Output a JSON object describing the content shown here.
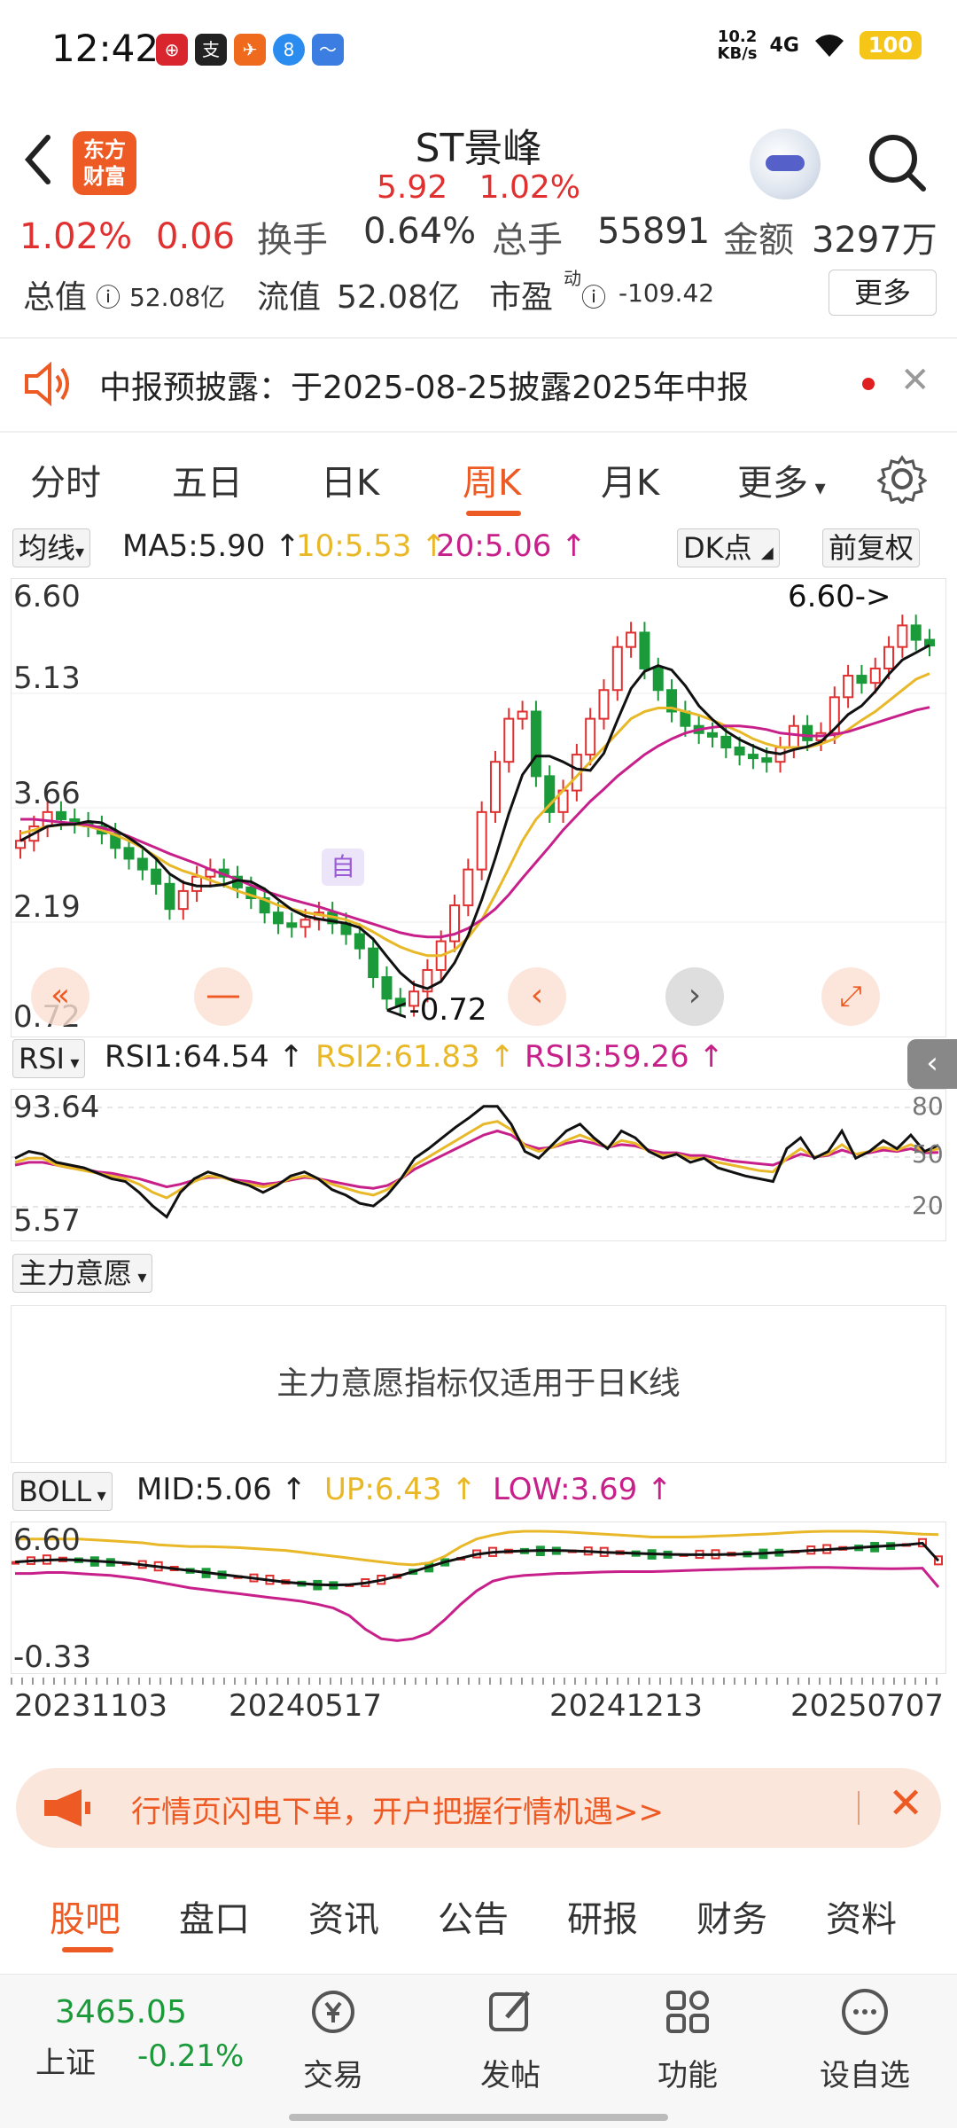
{
  "status": {
    "time": "12:42",
    "net_speed": "10.2",
    "net_unit": "KB/s",
    "signal": "4G",
    "battery": "100"
  },
  "header": {
    "logo_text_top": "东方",
    "logo_text_bottom": "财富",
    "stock_name": "ST景峰",
    "price": "5.92",
    "change_pct": "1.02%"
  },
  "quote": {
    "pct": "1.02%",
    "change": "0.06",
    "turnover_label": "换手",
    "turnover_value": "0.64%",
    "volume_label": "总手",
    "volume_value": "55891",
    "amount_label": "金额",
    "amount_value": "3297万",
    "total_value_label": "总值",
    "total_value": "52.08亿",
    "float_value_label": "流值",
    "float_value": "52.08亿",
    "pe_label": "市盈",
    "pe_sup": "动",
    "pe_value": "-109.42",
    "more_label": "更多"
  },
  "notice": {
    "text": "中报预披露：于2025-08-25披露2025年中报"
  },
  "tabs": [
    "分时",
    "五日",
    "日K",
    "周K",
    "月K",
    "更多"
  ],
  "active_tab_index": 3,
  "ma": {
    "selector": "均线",
    "ma5": "MA5:5.90 ↑",
    "ma10": "10:5.53 ↑",
    "ma20": "20:5.06 ↑",
    "dk": "DK点",
    "adjust": "前复权",
    "y_top": "6.60",
    "y_mid1": "5.13",
    "y_mid2": "3.66",
    "y_mid3": "2.19",
    "y_bottom": "0.72",
    "max_label": "6.60->",
    "min_label": "<-0.72",
    "self_label": "自"
  },
  "rsi": {
    "selector": "RSI",
    "rsi1": "RSI1:64.54 ↑",
    "rsi2": "RSI2:61.83 ↑",
    "rsi3": "RSI3:59.26 ↑",
    "y_top": "93.64",
    "y_bottom": "5.57",
    "r80": "80",
    "r50": "50",
    "r20": "20"
  },
  "main_force": {
    "selector": "主力意愿",
    "message": "主力意愿指标仅适用于日K线"
  },
  "boll": {
    "selector": "BOLL",
    "mid": "MID:5.06 ↑",
    "up": "UP:6.43 ↑",
    "low": "LOW:3.69 ↑",
    "y_top": "6.60",
    "y_bottom": "-0.33"
  },
  "dates": [
    "20231103",
    "20240517",
    "20241213",
    "20250707"
  ],
  "ad": {
    "text": "行情页闪电下单，开户把握行情机遇>>"
  },
  "bottom_tabs": [
    "股吧",
    "盘口",
    "资讯",
    "公告",
    "研报",
    "财务",
    "资料"
  ],
  "dock": {
    "index_value": "3465.05",
    "index_name": "上证",
    "index_pct": "-0.21%",
    "items": [
      "交易",
      "发帖",
      "功能",
      "设自选"
    ]
  },
  "colors": {
    "accent": "#ee5a24",
    "up": "#e03030",
    "down": "#1b9a3a",
    "ma10": "#e8b828",
    "ma20": "#c8208a"
  },
  "chart_data": {
    "type": "candlestick",
    "period": "weekly",
    "ylim": [
      0.72,
      6.6
    ],
    "close": [
      3.2,
      3.4,
      3.6,
      3.5,
      3.45,
      3.4,
      3.3,
      3.1,
      2.95,
      2.8,
      2.6,
      2.25,
      2.5,
      2.7,
      2.8,
      2.7,
      2.55,
      2.4,
      2.2,
      2.05,
      2.0,
      2.1,
      2.2,
      2.05,
      1.9,
      1.7,
      1.3,
      1.0,
      0.9,
      1.1,
      1.4,
      1.8,
      2.3,
      2.8,
      3.6,
      4.3,
      4.9,
      5.0,
      4.1,
      3.6,
      3.9,
      4.4,
      4.9,
      5.3,
      5.9,
      6.1,
      5.6,
      5.3,
      5.0,
      4.8,
      4.7,
      4.65,
      4.5,
      4.4,
      4.35,
      4.3,
      4.5,
      4.8,
      4.6,
      4.7,
      5.2,
      5.5,
      5.4,
      5.6,
      5.9,
      6.2,
      6.0,
      5.92
    ],
    "ma10": [
      3.3,
      3.35,
      3.4,
      3.42,
      3.43,
      3.4,
      3.35,
      3.28,
      3.2,
      3.1,
      2.98,
      2.86,
      2.78,
      2.72,
      2.65,
      2.58,
      2.5,
      2.44,
      2.38,
      2.3,
      2.25,
      2.2,
      2.17,
      2.14,
      2.1,
      2.03,
      1.93,
      1.82,
      1.72,
      1.65,
      1.6,
      1.6,
      1.68,
      1.85,
      2.1,
      2.45,
      2.82,
      3.2,
      3.5,
      3.7,
      3.9,
      4.1,
      4.3,
      4.5,
      4.7,
      4.9,
      5.0,
      5.05,
      5.05,
      5.0,
      4.95,
      4.88,
      4.8,
      4.72,
      4.62,
      4.55,
      4.5,
      4.5,
      4.5,
      4.55,
      4.62,
      4.75,
      4.88,
      5.0,
      5.15,
      5.3,
      5.45,
      5.53
    ],
    "ma20": [
      3.5,
      3.5,
      3.48,
      3.46,
      3.44,
      3.42,
      3.38,
      3.33,
      3.26,
      3.18,
      3.1,
      3.02,
      2.95,
      2.88,
      2.8,
      2.73,
      2.66,
      2.58,
      2.5,
      2.44,
      2.38,
      2.33,
      2.28,
      2.22,
      2.16,
      2.1,
      2.04,
      1.98,
      1.92,
      1.88,
      1.86,
      1.86,
      1.9,
      1.98,
      2.1,
      2.25,
      2.45,
      2.68,
      2.9,
      3.12,
      3.35,
      3.55,
      3.75,
      3.92,
      4.1,
      4.25,
      4.4,
      4.52,
      4.62,
      4.7,
      4.75,
      4.78,
      4.8,
      4.8,
      4.78,
      4.75,
      4.7,
      4.68,
      4.66,
      4.66,
      4.68,
      4.72,
      4.78,
      4.84,
      4.9,
      4.96,
      5.02,
      5.06
    ],
    "rsi1": [
      55,
      60,
      58,
      52,
      50,
      48,
      44,
      40,
      38,
      30,
      20,
      12,
      30,
      40,
      45,
      42,
      38,
      35,
      30,
      35,
      42,
      45,
      40,
      32,
      28,
      22,
      20,
      28,
      40,
      55,
      62,
      70,
      78,
      85,
      93,
      93,
      80,
      60,
      55,
      65,
      75,
      80,
      70,
      62,
      75,
      70,
      60,
      55,
      58,
      52,
      55,
      48,
      45,
      42,
      40,
      38,
      62,
      70,
      55,
      60,
      75,
      55,
      60,
      68,
      62,
      72,
      60,
      64.54
    ],
    "rsi2": [
      52,
      55,
      55,
      50,
      48,
      46,
      44,
      42,
      40,
      36,
      30,
      26,
      32,
      38,
      42,
      41,
      38,
      36,
      34,
      36,
      40,
      42,
      40,
      36,
      33,
      30,
      28,
      32,
      40,
      50,
      56,
      62,
      68,
      74,
      80,
      82,
      76,
      64,
      60,
      63,
      68,
      72,
      68,
      63,
      68,
      66,
      60,
      57,
      58,
      55,
      55,
      52,
      50,
      48,
      46,
      45,
      55,
      62,
      56,
      58,
      65,
      58,
      60,
      63,
      61,
      65,
      60,
      61.83
    ],
    "rsi3": [
      50,
      52,
      52,
      50,
      48,
      47,
      45,
      44,
      42,
      40,
      37,
      34,
      36,
      39,
      41,
      41,
      39,
      38,
      36,
      37,
      39,
      41,
      40,
      38,
      36,
      34,
      33,
      35,
      40,
      47,
      52,
      57,
      62,
      67,
      72,
      75,
      72,
      65,
      62,
      63,
      66,
      68,
      66,
      63,
      65,
      64,
      61,
      59,
      59,
      57,
      57,
      55,
      53,
      52,
      51,
      50,
      54,
      58,
      56,
      57,
      61,
      58,
      59,
      61,
      60,
      62,
      59,
      59.26
    ],
    "boll_up": [
      6.2,
      6.2,
      6.2,
      6.2,
      6.2,
      6.15,
      6.1,
      6.05,
      6.0,
      5.9,
      5.85,
      5.8,
      5.8,
      5.78,
      5.75,
      5.7,
      5.65,
      5.6,
      5.5,
      5.4,
      5.3,
      5.2,
      5.1,
      5.0,
      4.9,
      4.85,
      4.95,
      5.3,
      5.8,
      6.2,
      6.4,
      6.55,
      6.6,
      6.6,
      6.58,
      6.55,
      6.5,
      6.45,
      6.4,
      6.35,
      6.3,
      6.3,
      6.3,
      6.32,
      6.35,
      6.38,
      6.42,
      6.45,
      6.5,
      6.55,
      6.58,
      6.6,
      6.6,
      6.6,
      6.58,
      6.55,
      6.5,
      6.45,
      6.43
    ],
    "boll_mid": [
      5.0,
      5.05,
      5.1,
      5.12,
      5.1,
      5.05,
      5.0,
      4.95,
      4.85,
      4.75,
      4.65,
      4.55,
      4.45,
      4.35,
      4.25,
      4.15,
      4.05,
      3.95,
      3.88,
      3.82,
      3.8,
      3.82,
      3.9,
      4.05,
      4.25,
      4.5,
      4.75,
      5.0,
      5.2,
      5.4,
      5.5,
      5.55,
      5.58,
      5.6,
      5.6,
      5.58,
      5.55,
      5.5,
      5.48,
      5.45,
      5.42,
      5.4,
      5.38,
      5.38,
      5.38,
      5.4,
      5.42,
      5.45,
      5.5,
      5.55,
      5.6,
      5.65,
      5.7,
      5.75,
      5.8,
      5.85,
      5.9,
      5.98,
      5.06
    ],
    "boll_low": [
      4.4,
      4.4,
      4.45,
      4.45,
      4.4,
      4.35,
      4.3,
      4.2,
      4.1,
      3.95,
      3.8,
      3.65,
      3.55,
      3.45,
      3.35,
      3.25,
      3.15,
      3.05,
      2.95,
      2.8,
      2.6,
      2.2,
      1.5,
      1.0,
      0.9,
      1.0,
      1.3,
      2.0,
      2.8,
      3.5,
      4.0,
      4.2,
      4.3,
      4.35,
      4.4,
      4.42,
      4.45,
      4.48,
      4.5,
      4.5,
      4.5,
      4.52,
      4.55,
      4.58,
      4.6,
      4.62,
      4.65,
      4.66,
      4.68,
      4.7,
      4.72,
      4.72,
      4.7,
      4.68,
      4.66,
      4.65,
      4.66,
      4.68,
      3.69
    ]
  }
}
